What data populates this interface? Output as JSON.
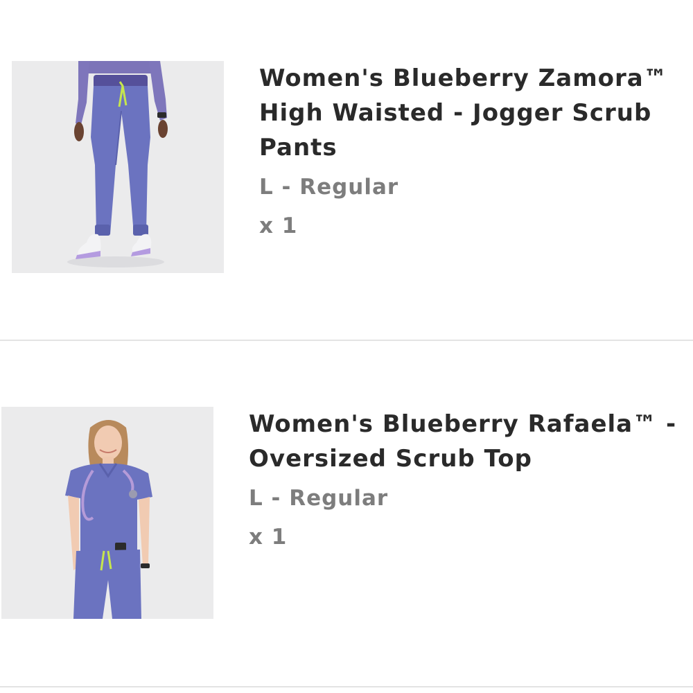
{
  "cart": {
    "items": [
      {
        "title_lines": [
          "Women's Blueberry Zamora™",
          "High Waisted - Jogger Scrub",
          "Pants"
        ],
        "variant": "L - Regular",
        "quantity": "x 1",
        "colors": {
          "garment": "#6b73c0",
          "accent": "#c6e64d",
          "top": "#7c74b8"
        }
      },
      {
        "title_lines": [
          "Women's Blueberry Rafaela™ -",
          "Oversized Scrub Top"
        ],
        "variant": "L - Regular",
        "quantity": "x 1",
        "colors": {
          "garment": "#6b73c0",
          "accent": "#c6e64d",
          "stethoscope": "#b59bd8"
        }
      }
    ]
  }
}
